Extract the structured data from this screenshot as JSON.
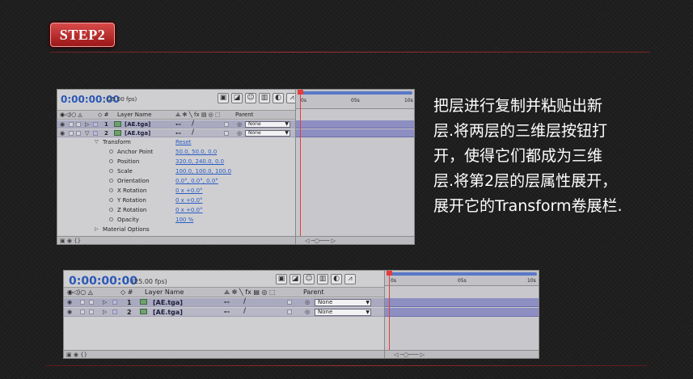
{
  "step_label": "STEP2",
  "instruction_lines": [
    "把层进行复制并粘贴出新",
    "层.将两层的三维层按钮打",
    "开，使得它们都成为三维",
    "层.将第2层的层属性展开，",
    "展开它的Transform卷展栏."
  ],
  "panels": [
    {
      "timecode": "0:00:00:00",
      "fps": "(25.00 fps)",
      "header": {
        "layer_name": "Layer Name",
        "parent": "Parent"
      },
      "layers": [
        {
          "number": "1",
          "name": "[AE.tga]",
          "parent": "None"
        },
        {
          "number": "2",
          "name": "[AE.tga]",
          "parent": "None"
        }
      ],
      "transform": {
        "label": "Transform",
        "reset": "Reset",
        "properties": [
          {
            "name": "Anchor Point",
            "value": "50.0, 50.0, 0.0"
          },
          {
            "name": "Position",
            "value": "320.0, 240.0, 0.0"
          },
          {
            "name": "Scale",
            "value": "100.0, 100.0, 100.0"
          },
          {
            "name": "Orientation",
            "value": "0.0°, 0.0°, 0.0°"
          },
          {
            "name": "X Rotation",
            "value": "0 x +0.0°"
          },
          {
            "name": "Y Rotation",
            "value": "0 x +0.0°"
          },
          {
            "name": "Z Rotation",
            "value": "0 x +0.0°"
          },
          {
            "name": "Opacity",
            "value": "100 %"
          }
        ]
      },
      "material_options": "Material Options",
      "ruler": {
        "start": "0s",
        "mid": "05s",
        "end": "10s"
      }
    },
    {
      "timecode": "0:00:00:00",
      "fps": "(25.00 fps)",
      "header": {
        "layer_name": "Layer Name",
        "parent": "Parent"
      },
      "layers": [
        {
          "number": "1",
          "name": "[AE.tga]",
          "parent": "None"
        },
        {
          "number": "2",
          "name": "[AE.tga]",
          "parent": "None"
        }
      ],
      "ruler": {
        "start": "0s",
        "mid": "05s",
        "end": "10s"
      }
    }
  ]
}
